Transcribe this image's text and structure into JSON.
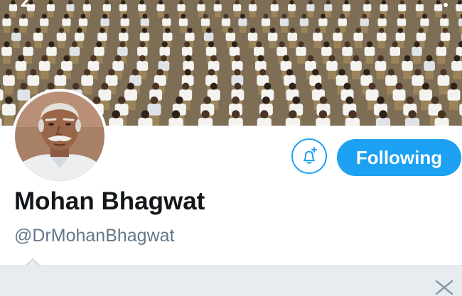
{
  "profile": {
    "display_name": "Mohan Bhagwat",
    "handle": "@DrMohanBhagwat"
  },
  "actions": {
    "following_label": "Following",
    "notify_icon": "bell-plus-icon"
  },
  "header": {
    "back_icon": "back-arrow-icon",
    "more_icon": "more-options-icon"
  },
  "suggestions": {
    "close_icon": "close-icon"
  },
  "colors": {
    "accent": "#1da1f2",
    "name": "#14171a",
    "handle": "#657786",
    "panel": "#e6ecf0"
  }
}
